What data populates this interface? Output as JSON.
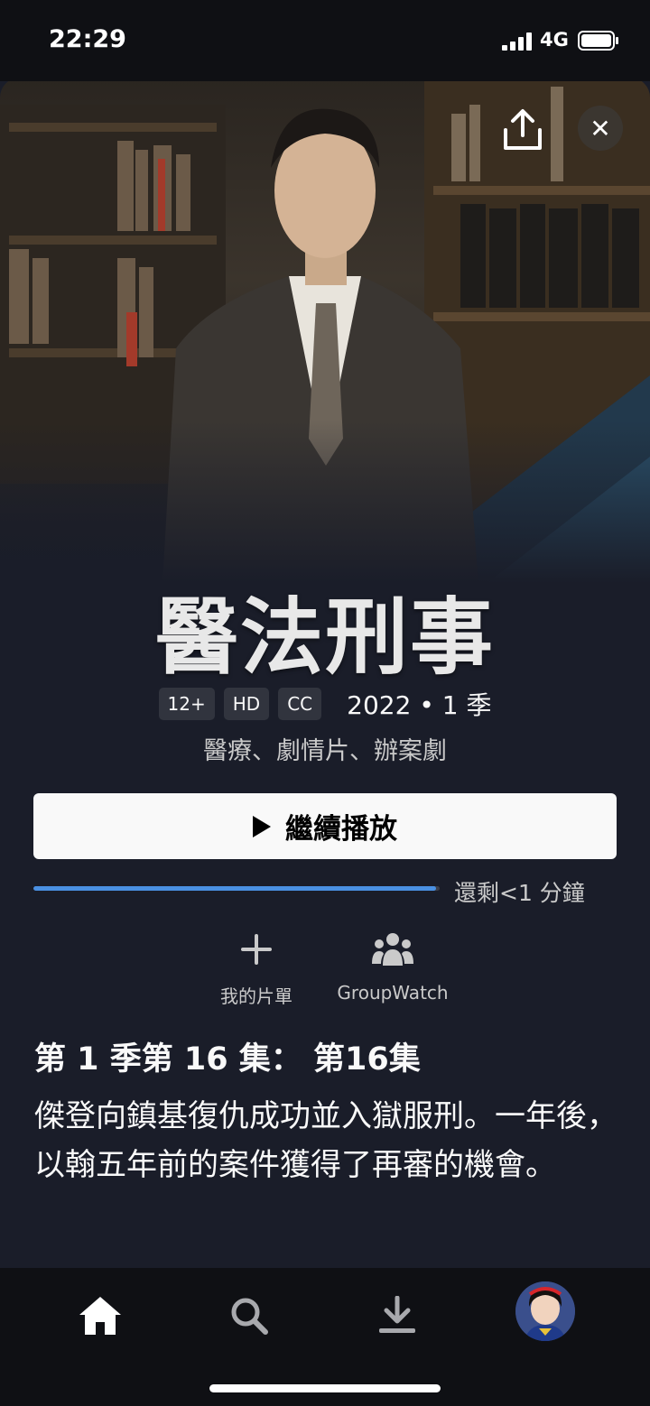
{
  "status_bar": {
    "time": "22:29",
    "network": "4G"
  },
  "title": {
    "name": "醫法刑事"
  },
  "meta": {
    "badges": [
      "12+",
      "HD",
      "CC"
    ],
    "year_seasons": "2022 • 1 季",
    "genres": "醫療、劇情片、辦案劇"
  },
  "play": {
    "label": "繼續播放",
    "remaining": "還剩<1 分鐘",
    "progress": 0.99
  },
  "actions": [
    {
      "label": "我的片單",
      "icon": "plus-icon"
    },
    {
      "label": "GroupWatch",
      "icon": "group-icon"
    }
  ],
  "episode": {
    "title": "第 1 季第 16 集： 第16集",
    "description": "傑登向鎮基復仇成功並入獄服刑。一年後，以翰五年前的案件獲得了再審的機會。"
  },
  "tabs": [
    {
      "name": "home",
      "icon": "home-icon",
      "active": true
    },
    {
      "name": "search",
      "icon": "search-icon"
    },
    {
      "name": "downloads",
      "icon": "download-icon"
    },
    {
      "name": "profile",
      "icon": "avatar"
    }
  ],
  "colors": {
    "background": "#1a1d29",
    "accent": "#4a90e2",
    "button": "#f9f9f9"
  }
}
